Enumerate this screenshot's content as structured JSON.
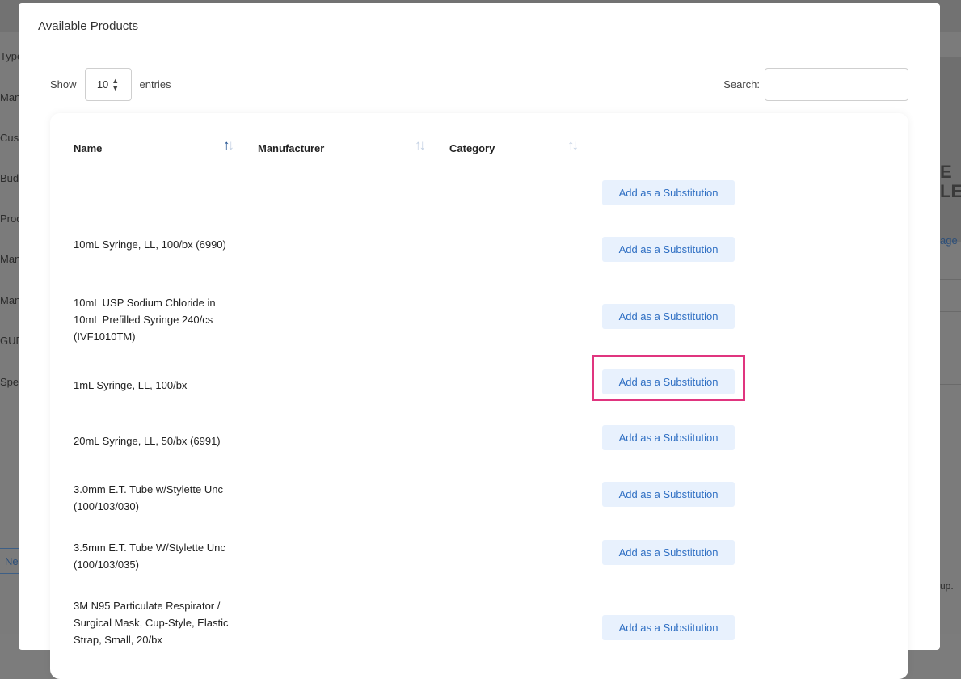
{
  "backdrop": {
    "labels": [
      "Type",
      "Man",
      "Cust",
      "Bud",
      "Prod",
      "Man",
      "Man",
      "GUD",
      "Spe"
    ],
    "big_text": [
      "E",
      "LE"
    ],
    "link_text": "age",
    "button_text": "Ne",
    "note_text": "up."
  },
  "modal": {
    "title": "Available Products",
    "show_label": "Show",
    "entries_value": "10",
    "entries_label": "entries",
    "search_label": "Search:",
    "search_value": ""
  },
  "table": {
    "columns": [
      "Name",
      "Manufacturer",
      "Category"
    ],
    "sort_active_column": "Name",
    "rows": [
      {
        "name": "",
        "action": "Add as a Substitution"
      },
      {
        "name": "10mL Syringe, LL, 100/bx (6990)",
        "action": "Add as a Substitution"
      },
      {
        "name": "10mL USP Sodium Chloride in 10mL Prefilled Syringe 240/cs (IVF1010TM)",
        "action": "Add as a Substitution"
      },
      {
        "name": "1mL Syringe, LL, 100/bx",
        "action": "Add as a Substitution",
        "highlighted": true
      },
      {
        "name": "20mL Syringe, LL, 50/bx (6991)",
        "action": "Add as a Substitution"
      },
      {
        "name": "3.0mm E.T. Tube w/Stylette Unc (100/103/030)",
        "action": "Add as a Substitution"
      },
      {
        "name": "3.5mm E.T. Tube W/Stylette Unc (100/103/035)",
        "action": "Add as a Substitution"
      },
      {
        "name": "3M N95 Particulate Respirator / Surgical Mask, Cup-Style, Elastic Strap, Small, 20/bx",
        "action": "Add as a Substitution"
      }
    ]
  },
  "colors": {
    "highlight": "#e0357f",
    "button_bg": "#e8f1fd",
    "button_text": "#2f6fc3"
  }
}
